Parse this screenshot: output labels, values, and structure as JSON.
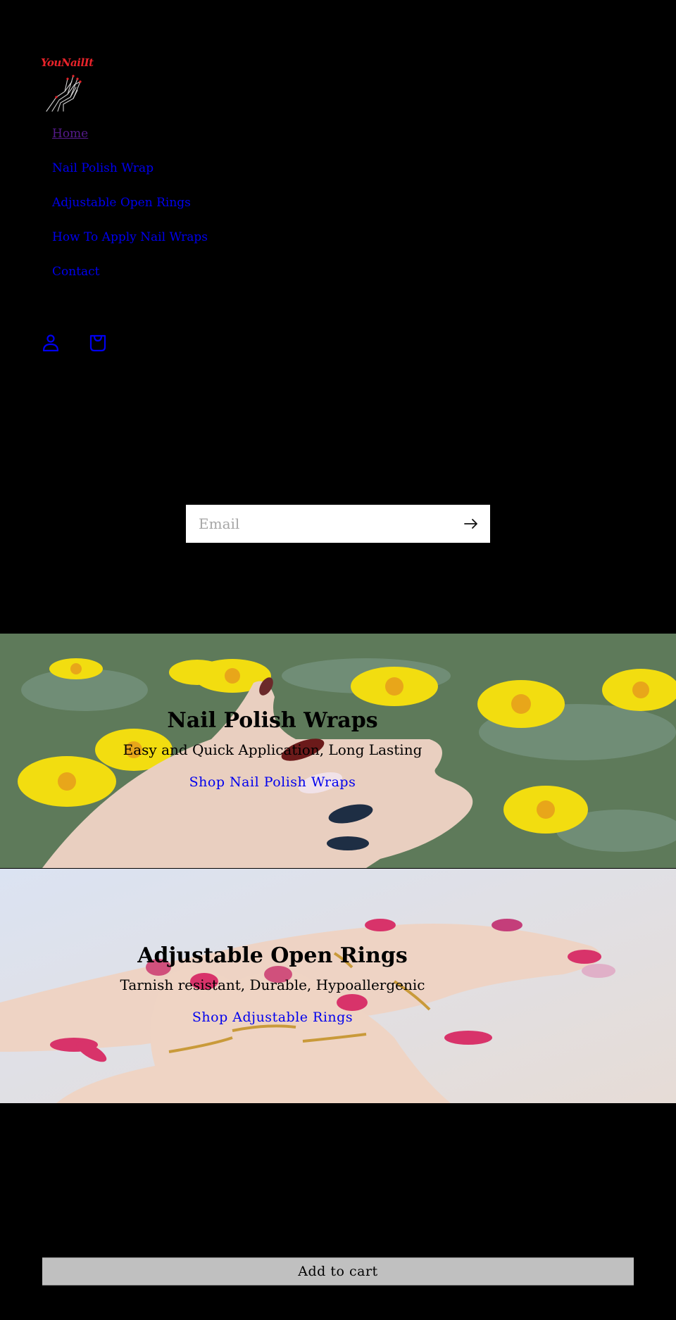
{
  "brand": {
    "name": "YouNailIt",
    "color": "#e8232a"
  },
  "nav": {
    "items": [
      {
        "label": "Home",
        "visited": true
      },
      {
        "label": "Nail Polish Wrap"
      },
      {
        "label": "Adjustable Open Rings"
      },
      {
        "label": "How To Apply Nail Wraps"
      },
      {
        "label": "Contact"
      }
    ],
    "link_color": "#0000ee",
    "visited_color": "#551a8b"
  },
  "header_icons": {
    "account": "account-icon",
    "cart": "cart-icon"
  },
  "newsletter": {
    "email_placeholder": "Email",
    "email_value": "",
    "submit_icon": "arrow-right-icon"
  },
  "banners": [
    {
      "title": "Nail Polish Wraps",
      "subtitle": "Easy and Quick Application, Long Lasting",
      "link": "Shop Nail Polish Wraps",
      "image": "hand-with-nail-wraps-yellow-daisies"
    },
    {
      "title": "Adjustable Open Rings",
      "subtitle": "Tarnish resistant, Durable, Hypoallergenic",
      "link": "Shop Adjustable Rings",
      "image": "hands-with-gold-rings-pink-nails"
    }
  ],
  "product": {
    "add_to_cart_label": "Add to cart"
  }
}
